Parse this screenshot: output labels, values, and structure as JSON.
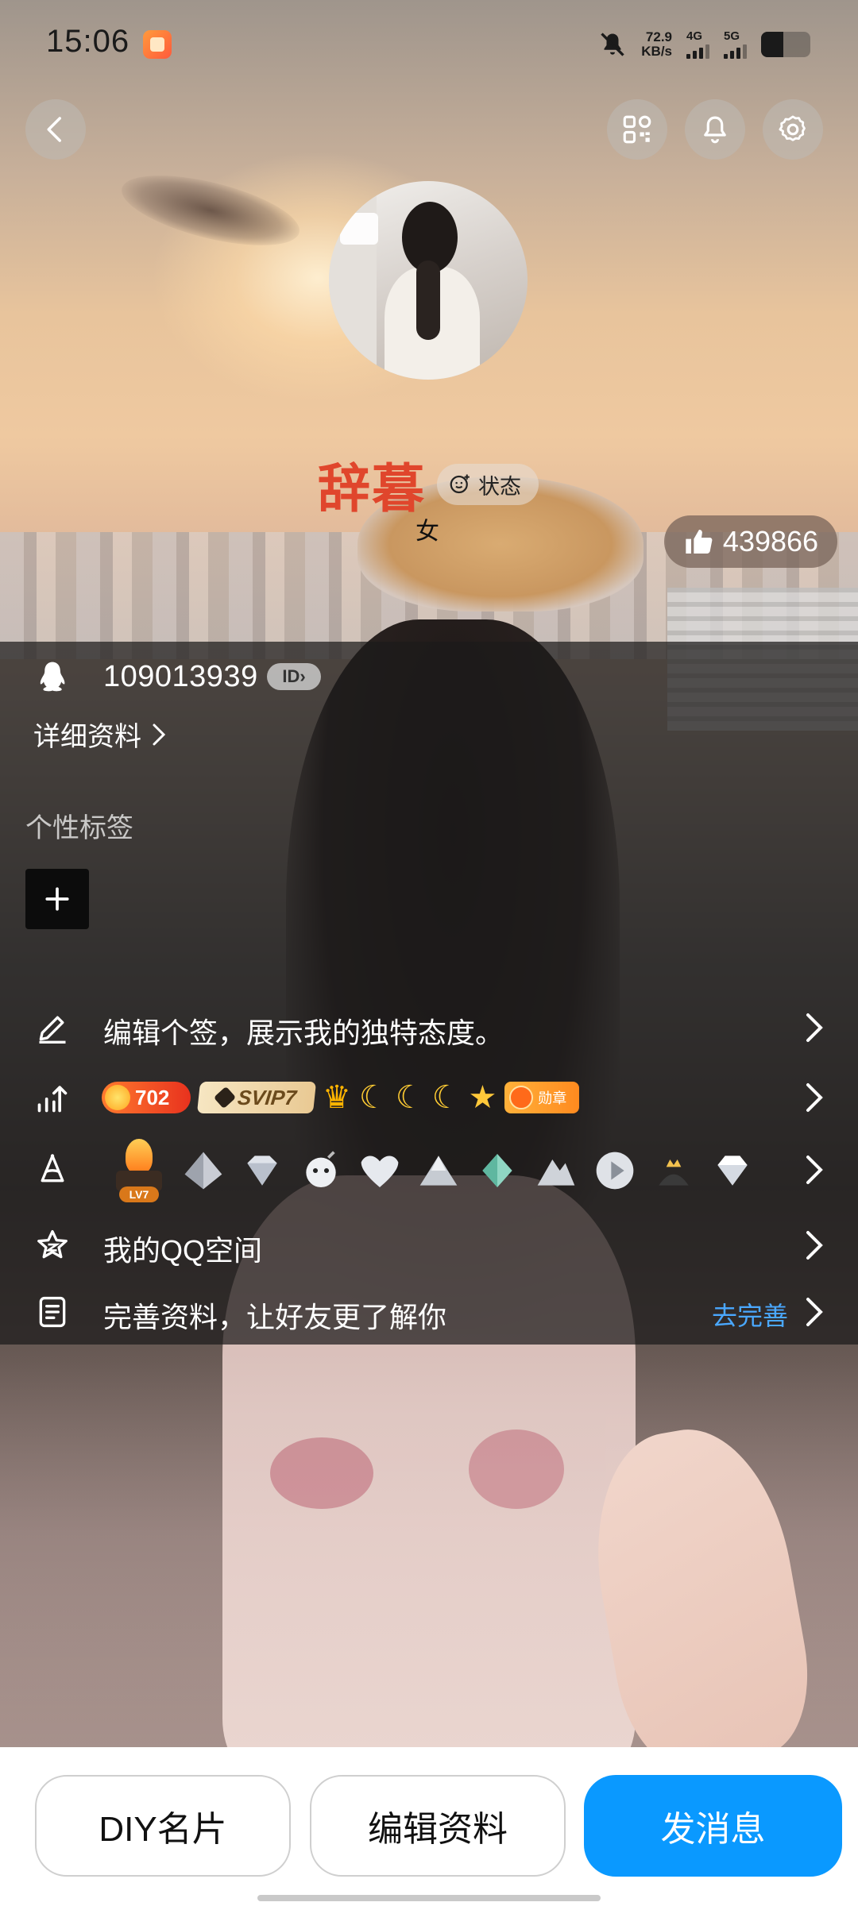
{
  "status_bar": {
    "time": "15:06",
    "net_speed_value": "72.9",
    "net_speed_unit": "KB/s",
    "signal_1": "4G",
    "signal_2": "5G",
    "icons": [
      "app-badge-icon",
      "mute-bell-icon",
      "battery-icon"
    ]
  },
  "nav": {
    "icons": [
      "back-icon",
      "qr-code-icon",
      "bell-icon",
      "settings-gear-icon"
    ]
  },
  "profile": {
    "username": "辞暮",
    "status_label": "状态",
    "gender": "女",
    "likes": "439866"
  },
  "info": {
    "qq_number": "109013939",
    "id_chip": "ID",
    "detail_link": "详细资料",
    "tags_title": "个性标签",
    "signature_prompt": "编辑个签，展示我的独特态度。",
    "coin_level": "702",
    "svip_label": "SVIP7",
    "medal_label": "勋章",
    "lv_label": "LV7",
    "qzone_label": "我的QQ空间",
    "complete_prompt": "完善资料，让好友更了解你",
    "complete_link": "去完善"
  },
  "bottom_bar": {
    "diy_button": "DIY名片",
    "edit_button": "编辑资料",
    "message_button": "发消息"
  },
  "colors": {
    "username": "#e0462c",
    "primary_button": "#0a99ff",
    "link_blue": "#4aa8ff",
    "panel_bg": "rgba(28,26,26,0.72)"
  }
}
